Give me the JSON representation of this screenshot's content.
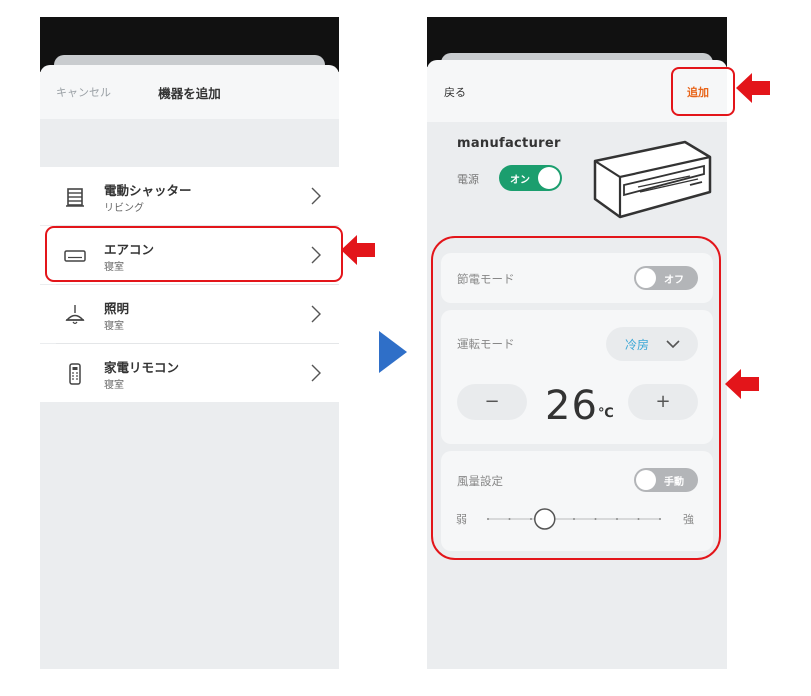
{
  "left": {
    "header": {
      "cancel": "キャンセル",
      "title": "機器を追加"
    },
    "items": [
      {
        "name": "電動シャッター",
        "room": "リビング",
        "icon": "shutter-icon"
      },
      {
        "name": "エアコン",
        "room": "寝室",
        "icon": "aircon-icon"
      },
      {
        "name": "照明",
        "room": "寝室",
        "icon": "ceiling-lamp-icon"
      },
      {
        "name": "家電リモコン",
        "room": "寝室",
        "icon": "remote-control-icon"
      }
    ]
  },
  "right": {
    "header": {
      "back": "戻る",
      "add": "追加"
    },
    "manufacturer": "manufacturer",
    "power": {
      "label": "電源",
      "state": "オン"
    },
    "eco": {
      "label": "節電モード",
      "state": "オフ"
    },
    "operation": {
      "label": "運転モード",
      "mode": "冷房",
      "temperature": "26",
      "unit": "℃",
      "minus": "−",
      "plus": "+"
    },
    "fan": {
      "label": "風量設定",
      "state": "手動",
      "weak": "弱",
      "strong": "強",
      "level": 0.33
    }
  },
  "colors": {
    "highlight": "#e3151a",
    "arrow_blue": "#2f6fc8",
    "toggle_on": "#1b9e6e",
    "add_text": "#e8651a",
    "mode_text": "#3ba7d6"
  }
}
